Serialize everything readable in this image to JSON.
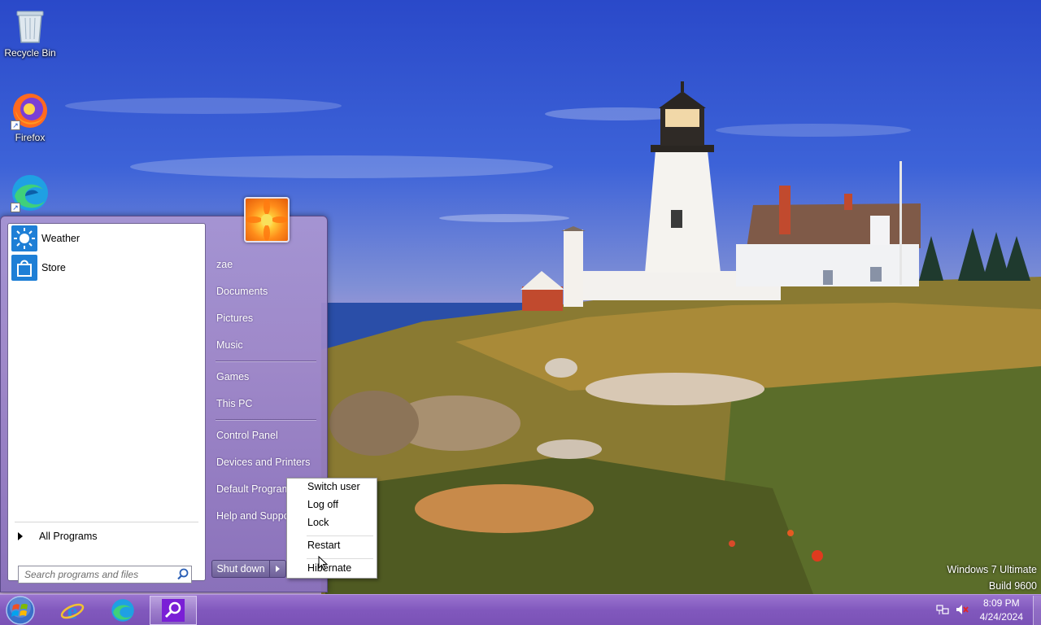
{
  "desktop": {
    "icons": [
      {
        "label": "Recycle Bin",
        "icon": "recycle-bin-icon"
      },
      {
        "label": "Firefox",
        "icon": "firefox-icon"
      },
      {
        "label": "",
        "icon": "edge-icon"
      }
    ],
    "watermark": {
      "line1": "Windows 7 Ultimate",
      "line2": "Build 9600"
    }
  },
  "start_menu": {
    "pinned": [
      {
        "label": "Weather",
        "icon": "weather-icon"
      },
      {
        "label": "Store",
        "icon": "store-icon"
      }
    ],
    "all_programs": "All Programs",
    "search": {
      "placeholder": "Search programs and files",
      "value": ""
    },
    "right_items": [
      {
        "label": "zae"
      },
      {
        "label": "Documents"
      },
      {
        "label": "Pictures"
      },
      {
        "label": "Music"
      },
      {
        "label": "Games"
      },
      {
        "label": "This PC"
      },
      {
        "label": "Control Panel"
      },
      {
        "label": "Devices and Printers"
      },
      {
        "label": "Default Programs"
      },
      {
        "label": "Help and Support"
      }
    ],
    "shutdown_label": "Shut down"
  },
  "power_menu": {
    "items": [
      "Switch user",
      "Log off",
      "Lock",
      "Restart",
      "Hibernate"
    ]
  },
  "taskbar": {
    "apps": [
      {
        "name": "Internet Explorer",
        "icon": "internet-explorer-icon"
      },
      {
        "name": "Microsoft Edge",
        "icon": "edge-icon"
      },
      {
        "name": "Search",
        "icon": "magnifier-icon"
      }
    ],
    "clock": {
      "time": "8:09 PM",
      "date": "4/24/2024"
    },
    "tray_icons": [
      "network-icon",
      "volume-muted-icon"
    ]
  }
}
